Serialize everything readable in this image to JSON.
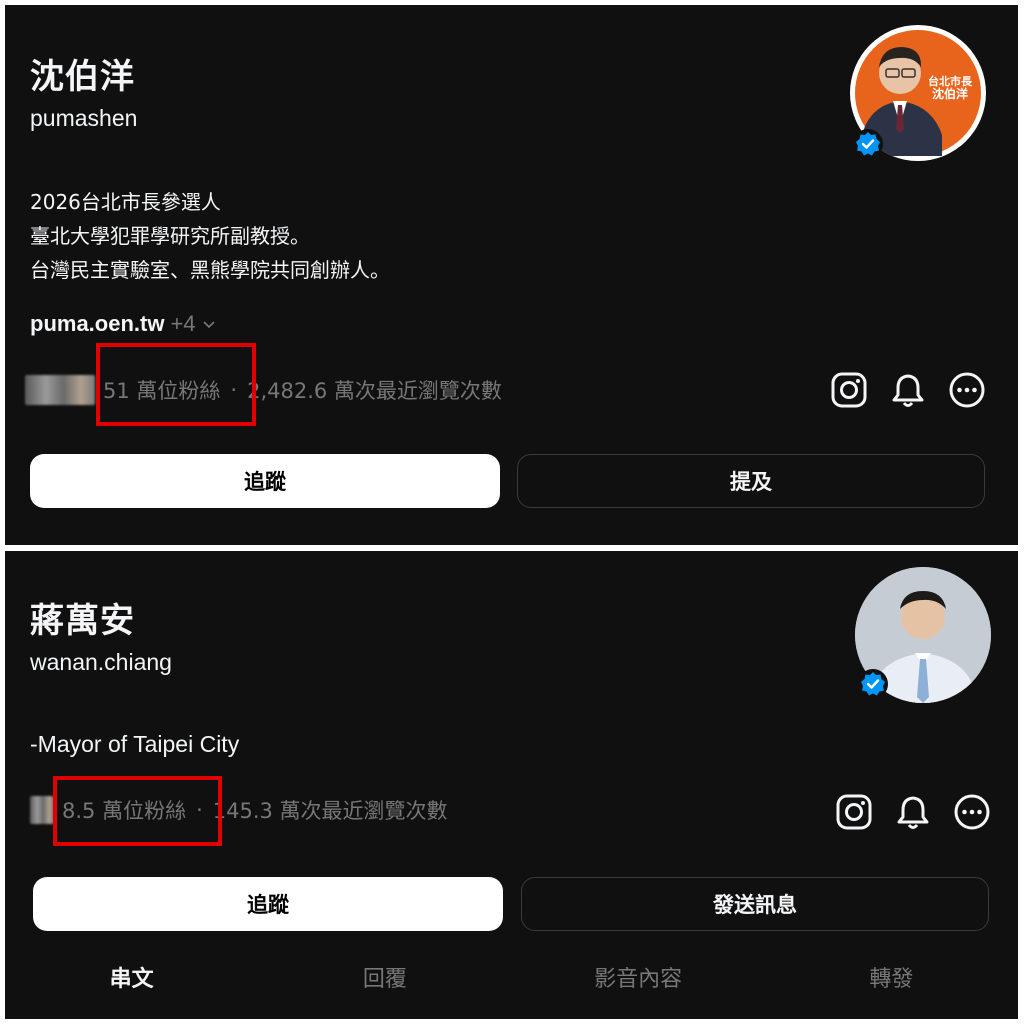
{
  "profile1": {
    "name": "沈伯洋",
    "handle": "pumashen",
    "bio": [
      "2026台北市長參選人",
      "臺北大學犯罪學研究所副教授。",
      "台灣民主實驗室、黑熊學院共同創辦人。"
    ],
    "link": "puma.oen.tw",
    "link_more": "+4",
    "followers": "51 萬位粉絲",
    "separator": "·",
    "views": "2,482.6 萬次最近瀏覽次數",
    "follow_label": "追蹤",
    "secondary_label": "提及",
    "avatar_sign": [
      "台北市長",
      "沈伯洋"
    ],
    "verified": true
  },
  "profile2": {
    "name": "蔣萬安",
    "handle": "wanan.chiang",
    "bio": [
      "-Mayor of Taipei City"
    ],
    "followers": "8.5 萬位粉絲",
    "separator": "·",
    "views": "145.3 萬次最近瀏覽次數",
    "follow_label": "追蹤",
    "secondary_label": "發送訊息",
    "verified": true,
    "tabs": [
      "串文",
      "回覆",
      "影音內容",
      "轉發"
    ],
    "active_tab": "串文"
  },
  "icons": [
    "instagram-icon",
    "bell-icon",
    "more-options-icon",
    "verified-badge-icon",
    "chevron-down-icon"
  ],
  "colors": {
    "background": "#101010",
    "text": "#f3f5f7",
    "muted": "#777777",
    "highlight": "#e00000",
    "verified": "#0095f6",
    "avatar1_bg": "#e8641c"
  }
}
